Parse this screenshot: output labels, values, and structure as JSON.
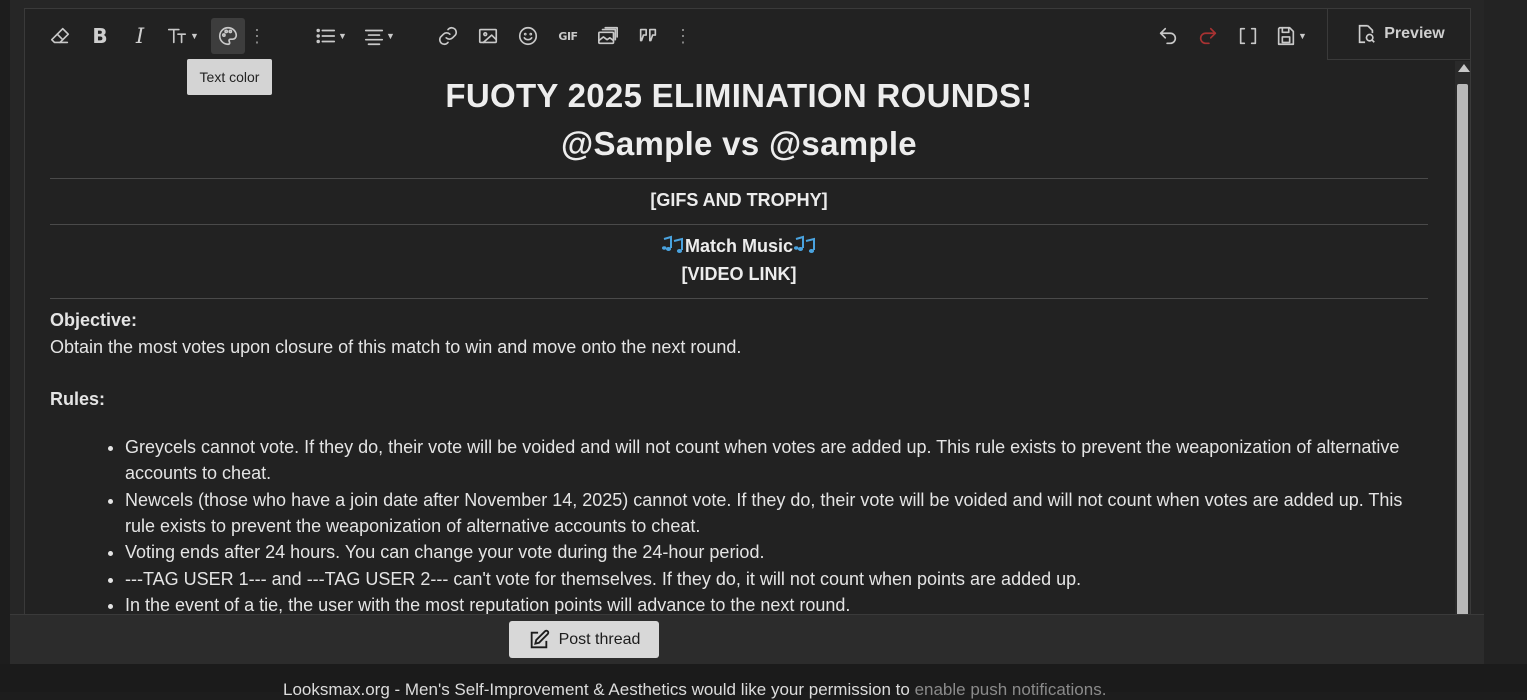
{
  "toolbar": {
    "tooltip": "Text color",
    "preview_label": "Preview",
    "gif_label": "GIF"
  },
  "content": {
    "title_line1": "FUOTY 2025 ELIMINATION ROUNDS!",
    "title_line2": "@Sample vs @sample",
    "gifs_trophy": "[GIFS AND TROPHY]",
    "music_label": "Match Music",
    "video_link": "[VIDEO LINK]",
    "objective_heading": "Objective:",
    "objective_text": "Obtain the most votes upon closure of this match to win and move onto the next round.",
    "rules_heading": "Rules:",
    "rules": [
      "Greycels cannot vote. If they do, their vote will be voided and will not count when votes are added up. This rule exists to prevent the weaponization of alternative accounts to cheat.",
      "Newcels (those who have a join date after November 14, 2025) cannot vote. If they do, their vote will be voided and will not count when votes are added up. This rule exists to prevent the weaponization of alternative accounts to cheat.",
      "Voting ends after 24 hours. You can change your vote during the 24-hour period.",
      "---TAG USER 1--- and ---TAG USER 2--- can't vote for themselves. If they do, it will not count when points are added up.",
      "In the event of a tie, the user with the most reputation points will advance to the next round."
    ]
  },
  "footer": {
    "post_button": "Post thread",
    "push_text": "Looksmax.org - Men's Self-Improvement & Aesthetics would like your permission to ",
    "push_link": "enable push notifications."
  },
  "colors": {
    "background": "#1d1d1d",
    "editor_bg": "#222222",
    "redo_icon": "#a83232",
    "emoji_blue": "#4aa3df"
  }
}
